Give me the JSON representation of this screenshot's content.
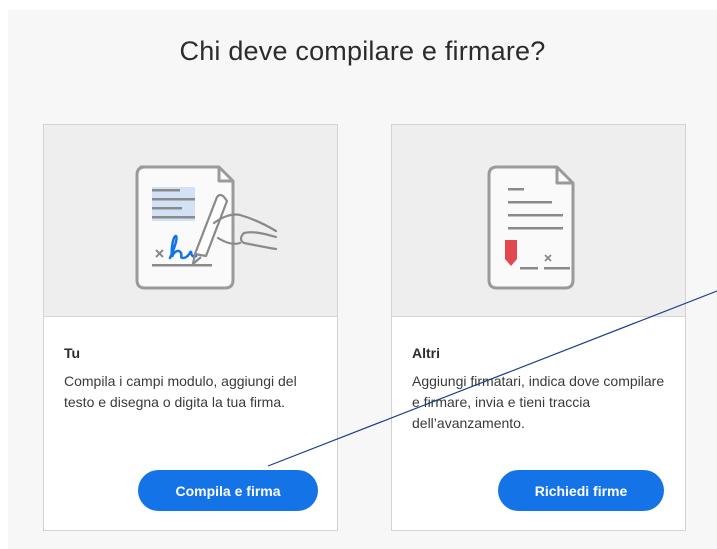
{
  "dialog": {
    "title": "Chi deve compilare e firmare?"
  },
  "cards": [
    {
      "title": "Tu",
      "description": "Compila i campi modulo, aggiungi del testo e disegna o digita la tua firma.",
      "button_label": "Compila e firma",
      "icon": "document-hand-sign-icon"
    },
    {
      "title": "Altri",
      "description": "Aggiungi firmatari, indica dove compilare e firmare, invia e tieni traccia dell’avanzamento.",
      "button_label": "Richiedi firme",
      "icon": "document-signature-request-icon"
    }
  ],
  "colors": {
    "accent": "#1473e6",
    "signature_marker": "#e34850",
    "annotation_line": "#1c3f8a"
  }
}
